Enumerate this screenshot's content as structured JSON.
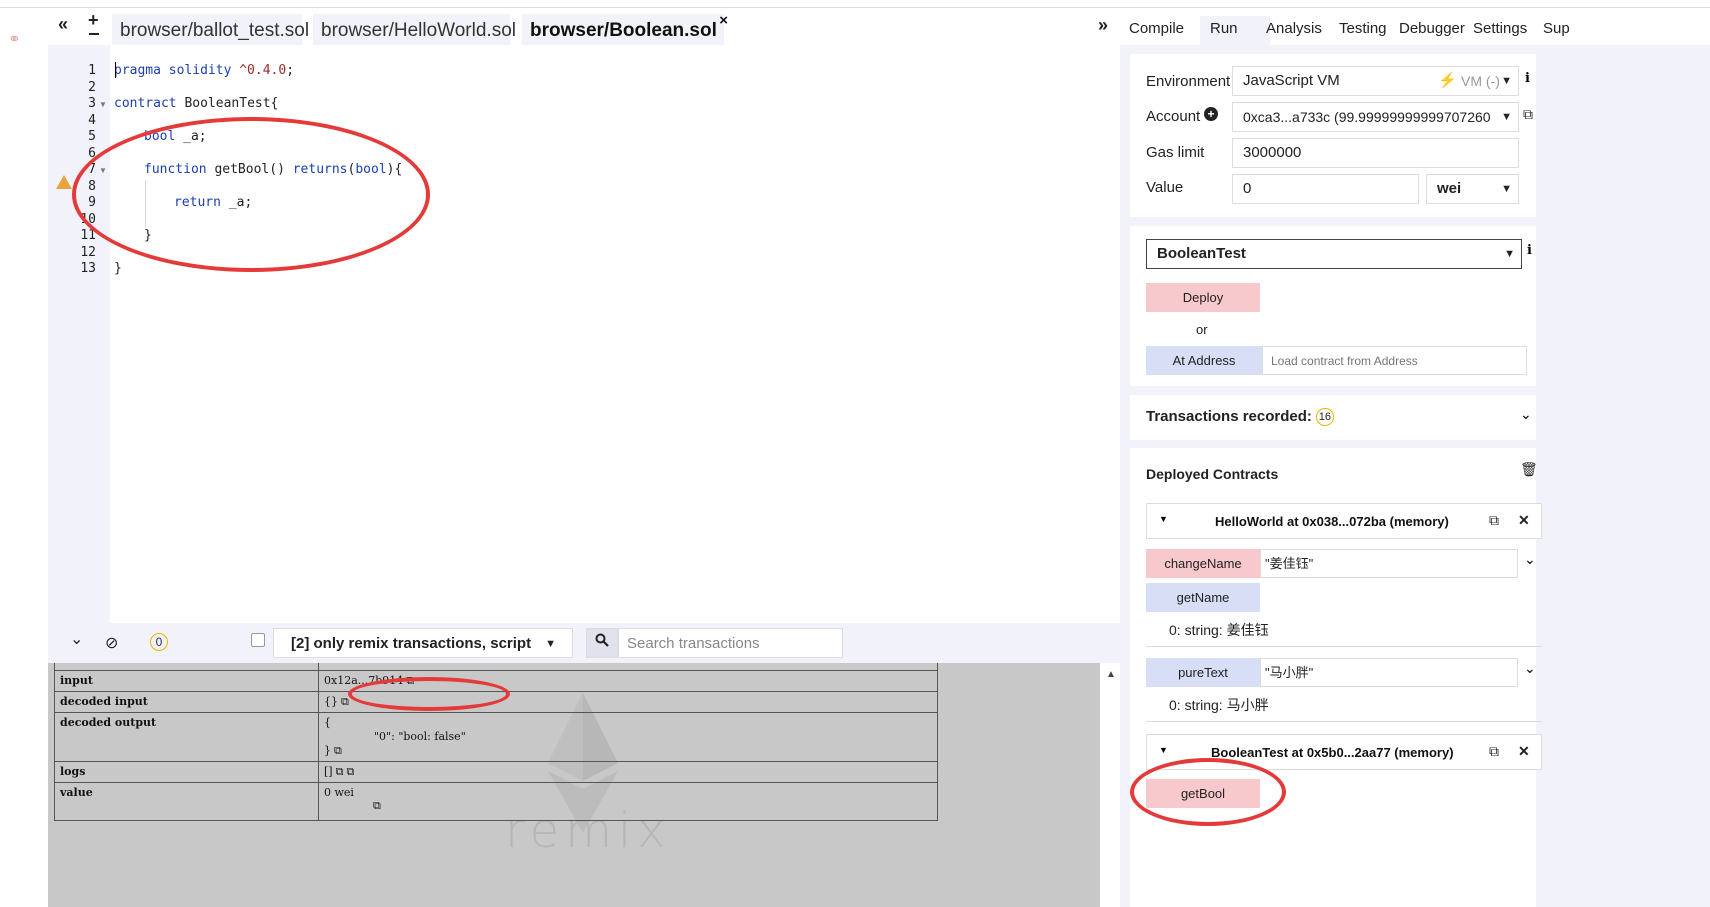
{
  "tabs_bar": {
    "collapse_left": "«",
    "add_file": "+",
    "files": [
      {
        "label": "browser/ballot_test.sol"
      },
      {
        "label": "browser/HelloWorld.sol"
      },
      {
        "label": "browser/Boolean.sol",
        "close": "×"
      }
    ],
    "collapse_right": "»"
  },
  "editor": {
    "line_numbers": [
      "1",
      "2",
      "3",
      "4",
      "5",
      "6",
      "7",
      "8",
      "9",
      "10",
      "11",
      "12",
      "13"
    ],
    "lines": {
      "l1_kw": "pragma solidity",
      "l1_ver": "^0.4.0",
      "l1_end": ";",
      "l3_kw": "contract",
      "l3_rest": " BooleanTest{",
      "l5_kw": "bool",
      "l5_rest": " _a;",
      "l7_kw": "function",
      "l7_name": " getBool() ",
      "l7_kw2": "returns",
      "l7_rest": "(",
      "l7_kw3": "bool",
      "l7_end": "){",
      "l9_kw": "return",
      "l9_rest": " _a;",
      "l11": "}",
      "l13": "}"
    }
  },
  "terminal": {
    "collapse_icon": "⌄",
    "clear_icon": "⊘",
    "pending_count": "0",
    "filter_label": "[2] only remix transactions, script",
    "search_icon": "🔍",
    "search_placeholder": "Search transactions"
  },
  "console": {
    "rows": [
      {
        "key": "input",
        "value": "0x12a...7b914"
      },
      {
        "key": "decoded input",
        "value": "{}"
      },
      {
        "key": "decoded output",
        "value_open": "{",
        "value_inner": "\"0\": \"bool: false\"",
        "value_close": "}"
      },
      {
        "key": "logs",
        "value": "[]"
      },
      {
        "key": "value",
        "value": "0 wei"
      }
    ],
    "watermark": "remix"
  },
  "right_tabs": [
    "Compile",
    "Run",
    "Analysis",
    "Testing",
    "Debugger",
    "Settings",
    "Sup"
  ],
  "run": {
    "environment_label": "Environment",
    "environment_value": "JavaScript VM",
    "environment_extra": "VM (-)",
    "account_label": "Account",
    "account_value": "0xca3...a733c (99.99999999999707260",
    "gas_label": "Gas limit",
    "gas_value": "3000000",
    "value_label": "Value",
    "value_amount": "0",
    "value_unit": "wei",
    "contract_select": "BooleanTest",
    "deploy_label": "Deploy",
    "or_label": "or",
    "at_address_label": "At Address",
    "at_address_placeholder": "Load contract from Address",
    "transactions_label": "Transactions recorded:",
    "transactions_count": "16",
    "deployed_label": "Deployed Contracts"
  },
  "instances": [
    {
      "title": "HelloWorld at 0x038...072ba (memory)",
      "functions": [
        {
          "name": "changeName",
          "arg": "\"姜佳钰\"",
          "kind": "red"
        },
        {
          "name": "getName",
          "kind": "blue",
          "result": "0: string: 姜佳钰"
        },
        {
          "name": "pureText",
          "arg": "\"马小胖\"",
          "kind": "blue",
          "result": "0: string: 马小胖"
        }
      ]
    },
    {
      "title": "BooleanTest at 0x5b0...2aa77 (memory)",
      "functions": [
        {
          "name": "getBool",
          "kind": "red"
        }
      ]
    }
  ],
  "colors": {
    "accent_red": "#e53a3a",
    "button_red": "#f8c9cc",
    "button_blue": "#d7def6",
    "panel_bg": "#f2f3fa"
  }
}
